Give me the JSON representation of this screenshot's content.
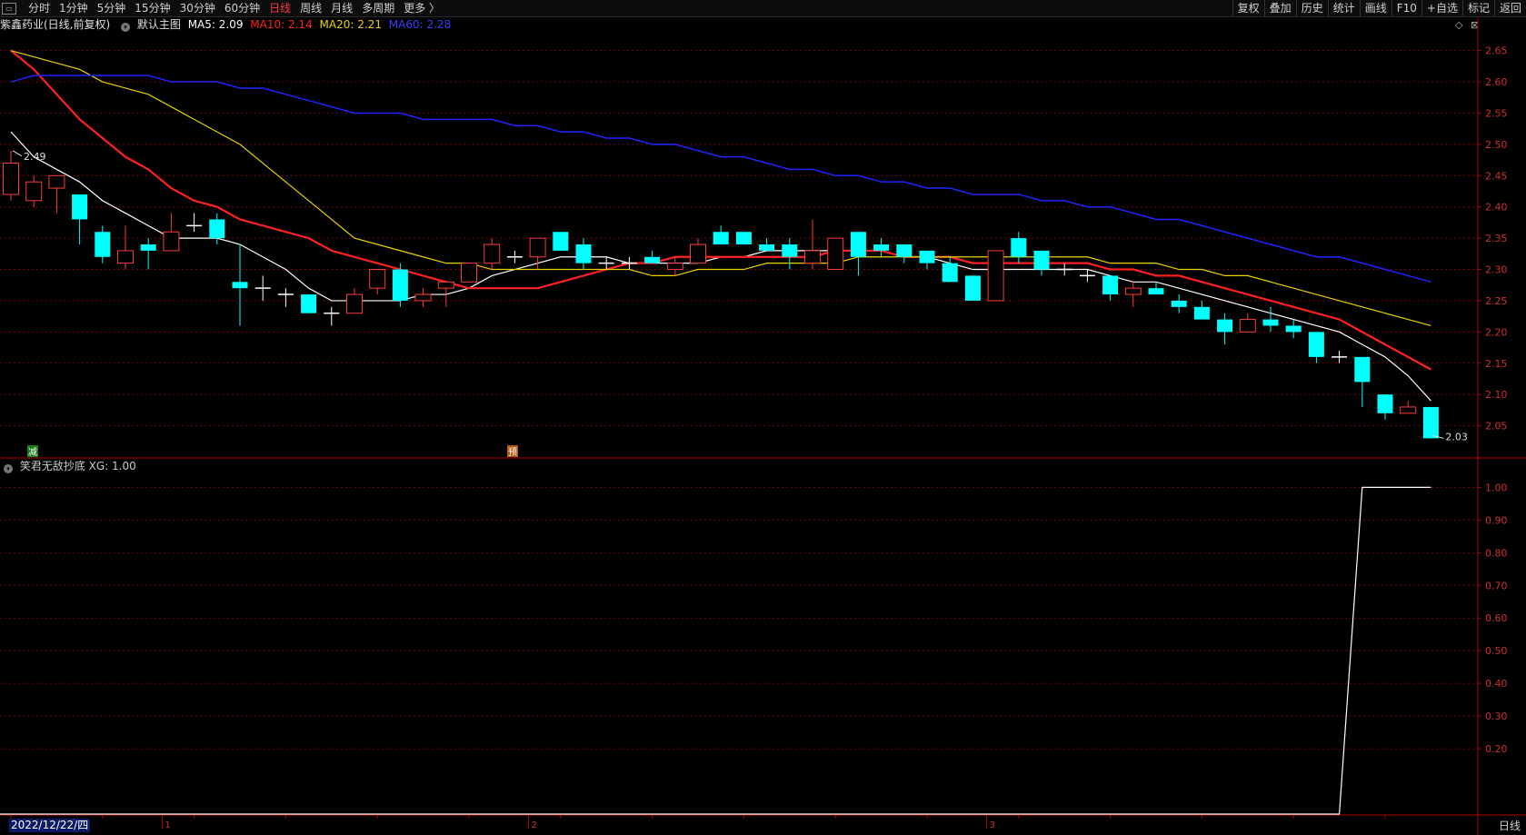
{
  "toolbar": {
    "periods": [
      "分时",
      "1分钟",
      "5分钟",
      "15分钟",
      "30分钟",
      "60分钟",
      "日线",
      "周线",
      "月线",
      "多周期",
      "更多 〉"
    ],
    "active_period": "日线",
    "tools": [
      "复权",
      "叠加",
      "历史",
      "统计",
      "画线",
      "F10",
      "+自选",
      "标记",
      "返回"
    ]
  },
  "info": {
    "stock": "紫鑫药业(日线,前复权)",
    "main_chart": "默认主图",
    "ma5": "MA5: 2.09",
    "ma10": "MA10: 2.14",
    "ma20": "MA20: 2.21",
    "ma60": "MA60: 2.28"
  },
  "indicator": {
    "label": "笑君无敌抄底",
    "value": "XG: 1.00"
  },
  "footer": {
    "date": "2022/12/22/四",
    "period_label": "日线"
  },
  "colors": {
    "up": "#ff3b3b",
    "down": "#00ffff",
    "ma5": "#ffffff",
    "ma10": "#ff2020",
    "ma20": "#e6d200",
    "ma60": "#2222ff",
    "grid": "#7a0000",
    "axis": "#b00000"
  },
  "markers": {
    "high": "2.49",
    "low": "2.03",
    "badge1": "减",
    "badge2": "预"
  },
  "chart_data": [
    {
      "type": "candlestick",
      "title": "紫鑫药业(日线,前复权)",
      "ylim": [
        2.0,
        2.68
      ],
      "yticks": [
        "2.65",
        "2.60",
        "2.55",
        "2.50",
        "2.45",
        "2.40",
        "2.35",
        "2.30",
        "2.25",
        "2.20",
        "2.15",
        "2.10",
        "2.05"
      ],
      "x_markers": [
        "1",
        "2",
        "3"
      ],
      "candles": [
        {
          "o": 2.42,
          "h": 2.49,
          "l": 2.41,
          "c": 2.47
        },
        {
          "o": 2.41,
          "h": 2.45,
          "l": 2.4,
          "c": 2.44
        },
        {
          "o": 2.43,
          "h": 2.45,
          "l": 2.39,
          "c": 2.45
        },
        {
          "o": 2.42,
          "h": 2.42,
          "l": 2.34,
          "c": 2.38
        },
        {
          "o": 2.36,
          "h": 2.37,
          "l": 2.31,
          "c": 2.32
        },
        {
          "o": 2.31,
          "h": 2.37,
          "l": 2.3,
          "c": 2.33
        },
        {
          "o": 2.34,
          "h": 2.35,
          "l": 2.3,
          "c": 2.33
        },
        {
          "o": 2.33,
          "h": 2.39,
          "l": 2.33,
          "c": 2.36
        },
        {
          "o": 2.37,
          "h": 2.39,
          "l": 2.36,
          "c": 2.37
        },
        {
          "o": 2.38,
          "h": 2.39,
          "l": 2.34,
          "c": 2.35
        },
        {
          "o": 2.28,
          "h": 2.34,
          "l": 2.21,
          "c": 2.27
        },
        {
          "o": 2.27,
          "h": 2.29,
          "l": 2.25,
          "c": 2.27
        },
        {
          "o": 2.26,
          "h": 2.27,
          "l": 2.24,
          "c": 2.26
        },
        {
          "o": 2.26,
          "h": 2.26,
          "l": 2.23,
          "c": 2.23
        },
        {
          "o": 2.23,
          "h": 2.24,
          "l": 2.21,
          "c": 2.23
        },
        {
          "o": 2.23,
          "h": 2.27,
          "l": 2.23,
          "c": 2.26
        },
        {
          "o": 2.27,
          "h": 2.3,
          "l": 2.26,
          "c": 2.3
        },
        {
          "o": 2.3,
          "h": 2.31,
          "l": 2.24,
          "c": 2.25
        },
        {
          "o": 2.25,
          "h": 2.27,
          "l": 2.24,
          "c": 2.26
        },
        {
          "o": 2.27,
          "h": 2.28,
          "l": 2.24,
          "c": 2.28
        },
        {
          "o": 2.28,
          "h": 2.31,
          "l": 2.28,
          "c": 2.31
        },
        {
          "o": 2.31,
          "h": 2.35,
          "l": 2.3,
          "c": 2.34
        },
        {
          "o": 2.32,
          "h": 2.33,
          "l": 2.31,
          "c": 2.32
        },
        {
          "o": 2.32,
          "h": 2.35,
          "l": 2.3,
          "c": 2.35
        },
        {
          "o": 2.36,
          "h": 2.36,
          "l": 2.33,
          "c": 2.33
        },
        {
          "o": 2.34,
          "h": 2.35,
          "l": 2.3,
          "c": 2.31
        },
        {
          "o": 2.31,
          "h": 2.32,
          "l": 2.3,
          "c": 2.31
        },
        {
          "o": 2.31,
          "h": 2.32,
          "l": 2.3,
          "c": 2.31
        },
        {
          "o": 2.32,
          "h": 2.33,
          "l": 2.31,
          "c": 2.31
        },
        {
          "o": 2.3,
          "h": 2.32,
          "l": 2.29,
          "c": 2.31
        },
        {
          "o": 2.31,
          "h": 2.35,
          "l": 2.31,
          "c": 2.34
        },
        {
          "o": 2.36,
          "h": 2.37,
          "l": 2.34,
          "c": 2.34
        },
        {
          "o": 2.36,
          "h": 2.36,
          "l": 2.34,
          "c": 2.34
        },
        {
          "o": 2.34,
          "h": 2.35,
          "l": 2.33,
          "c": 2.33
        },
        {
          "o": 2.34,
          "h": 2.35,
          "l": 2.3,
          "c": 2.32
        },
        {
          "o": 2.31,
          "h": 2.38,
          "l": 2.3,
          "c": 2.33
        },
        {
          "o": 2.3,
          "h": 2.35,
          "l": 2.3,
          "c": 2.35
        },
        {
          "o": 2.36,
          "h": 2.36,
          "l": 2.29,
          "c": 2.32
        },
        {
          "o": 2.34,
          "h": 2.35,
          "l": 2.32,
          "c": 2.33
        },
        {
          "o": 2.34,
          "h": 2.34,
          "l": 2.31,
          "c": 2.32
        },
        {
          "o": 2.33,
          "h": 2.33,
          "l": 2.3,
          "c": 2.31
        },
        {
          "o": 2.31,
          "h": 2.32,
          "l": 2.28,
          "c": 2.28
        },
        {
          "o": 2.29,
          "h": 2.29,
          "l": 2.25,
          "c": 2.25
        },
        {
          "o": 2.25,
          "h": 2.33,
          "l": 2.25,
          "c": 2.33
        },
        {
          "o": 2.35,
          "h": 2.36,
          "l": 2.31,
          "c": 2.32
        },
        {
          "o": 2.33,
          "h": 2.33,
          "l": 2.29,
          "c": 2.3
        },
        {
          "o": 2.3,
          "h": 2.31,
          "l": 2.29,
          "c": 2.3
        },
        {
          "o": 2.29,
          "h": 2.3,
          "l": 2.28,
          "c": 2.29
        },
        {
          "o": 2.29,
          "h": 2.29,
          "l": 2.25,
          "c": 2.26
        },
        {
          "o": 2.26,
          "h": 2.28,
          "l": 2.24,
          "c": 2.27
        },
        {
          "o": 2.27,
          "h": 2.28,
          "l": 2.26,
          "c": 2.26
        },
        {
          "o": 2.25,
          "h": 2.26,
          "l": 2.23,
          "c": 2.24
        },
        {
          "o": 2.24,
          "h": 2.25,
          "l": 2.22,
          "c": 2.22
        },
        {
          "o": 2.22,
          "h": 2.23,
          "l": 2.18,
          "c": 2.2
        },
        {
          "o": 2.2,
          "h": 2.23,
          "l": 2.2,
          "c": 2.22
        },
        {
          "o": 2.22,
          "h": 2.24,
          "l": 2.2,
          "c": 2.21
        },
        {
          "o": 2.21,
          "h": 2.22,
          "l": 2.19,
          "c": 2.2
        },
        {
          "o": 2.2,
          "h": 2.2,
          "l": 2.15,
          "c": 2.16
        },
        {
          "o": 2.16,
          "h": 2.17,
          "l": 2.15,
          "c": 2.16
        },
        {
          "o": 2.16,
          "h": 2.16,
          "l": 2.08,
          "c": 2.12
        },
        {
          "o": 2.1,
          "h": 2.1,
          "l": 2.06,
          "c": 2.07
        },
        {
          "o": 2.07,
          "h": 2.09,
          "l": 2.07,
          "c": 2.08
        },
        {
          "o": 2.08,
          "h": 2.08,
          "l": 2.03,
          "c": 2.03
        }
      ],
      "series": [
        {
          "name": "MA5",
          "values": [
            2.52,
            2.48,
            2.46,
            2.44,
            2.41,
            2.39,
            2.37,
            2.35,
            2.35,
            2.35,
            2.34,
            2.32,
            2.3,
            2.27,
            2.25,
            2.25,
            2.25,
            2.25,
            2.26,
            2.26,
            2.27,
            2.29,
            2.3,
            2.31,
            2.32,
            2.32,
            2.32,
            2.31,
            2.31,
            2.31,
            2.31,
            2.32,
            2.32,
            2.33,
            2.33,
            2.33,
            2.33,
            2.33,
            2.33,
            2.32,
            2.32,
            2.31,
            2.3,
            2.3,
            2.3,
            2.3,
            2.3,
            2.3,
            2.29,
            2.28,
            2.28,
            2.27,
            2.26,
            2.25,
            2.24,
            2.23,
            2.22,
            2.21,
            2.2,
            2.18,
            2.16,
            2.13,
            2.09
          ]
        },
        {
          "name": "MA10",
          "values": [
            2.65,
            2.62,
            2.58,
            2.54,
            2.51,
            2.48,
            2.46,
            2.43,
            2.41,
            2.4,
            2.38,
            2.37,
            2.36,
            2.35,
            2.33,
            2.32,
            2.31,
            2.3,
            2.29,
            2.28,
            2.27,
            2.27,
            2.27,
            2.27,
            2.28,
            2.29,
            2.3,
            2.31,
            2.31,
            2.32,
            2.32,
            2.32,
            2.32,
            2.32,
            2.32,
            2.32,
            2.33,
            2.33,
            2.33,
            2.32,
            2.32,
            2.32,
            2.31,
            2.31,
            2.31,
            2.31,
            2.31,
            2.31,
            2.3,
            2.3,
            2.29,
            2.29,
            2.28,
            2.27,
            2.26,
            2.25,
            2.24,
            2.23,
            2.22,
            2.2,
            2.18,
            2.16,
            2.14
          ]
        },
        {
          "name": "MA20",
          "values": [
            2.65,
            2.64,
            2.63,
            2.62,
            2.6,
            2.59,
            2.58,
            2.56,
            2.54,
            2.52,
            2.5,
            2.47,
            2.44,
            2.41,
            2.38,
            2.35,
            2.34,
            2.33,
            2.32,
            2.31,
            2.31,
            2.3,
            2.3,
            2.3,
            2.3,
            2.3,
            2.3,
            2.3,
            2.29,
            2.29,
            2.3,
            2.3,
            2.3,
            2.31,
            2.31,
            2.31,
            2.31,
            2.32,
            2.32,
            2.32,
            2.32,
            2.32,
            2.32,
            2.32,
            2.32,
            2.32,
            2.32,
            2.32,
            2.31,
            2.31,
            2.31,
            2.3,
            2.3,
            2.29,
            2.29,
            2.28,
            2.27,
            2.26,
            2.25,
            2.24,
            2.23,
            2.22,
            2.21
          ]
        },
        {
          "name": "MA60",
          "values": [
            2.6,
            2.61,
            2.61,
            2.61,
            2.61,
            2.61,
            2.61,
            2.6,
            2.6,
            2.6,
            2.59,
            2.59,
            2.58,
            2.57,
            2.56,
            2.55,
            2.55,
            2.55,
            2.54,
            2.54,
            2.54,
            2.54,
            2.53,
            2.53,
            2.52,
            2.52,
            2.51,
            2.51,
            2.5,
            2.5,
            2.49,
            2.48,
            2.48,
            2.47,
            2.46,
            2.46,
            2.45,
            2.45,
            2.44,
            2.44,
            2.43,
            2.43,
            2.42,
            2.42,
            2.42,
            2.41,
            2.41,
            2.4,
            2.4,
            2.39,
            2.38,
            2.38,
            2.37,
            2.36,
            2.35,
            2.34,
            2.33,
            2.32,
            2.32,
            2.31,
            2.3,
            2.29,
            2.28
          ]
        }
      ]
    },
    {
      "type": "line",
      "title": "笑君无敌抄底",
      "ylim": [
        0.0,
        1.04
      ],
      "yticks": [
        "1.00",
        "0.90",
        "0.80",
        "0.70",
        "0.60",
        "0.50",
        "0.40",
        "0.30",
        "0.20"
      ],
      "series": [
        {
          "name": "XG",
          "values": [
            0,
            0,
            0,
            0,
            0,
            0,
            0,
            0,
            0,
            0,
            0,
            0,
            0,
            0,
            0,
            0,
            0,
            0,
            0,
            0,
            0,
            0,
            0,
            0,
            0,
            0,
            0,
            0,
            0,
            0,
            0,
            0,
            0,
            0,
            0,
            0,
            0,
            0,
            0,
            0,
            0,
            0,
            0,
            0,
            0,
            0,
            0,
            0,
            0,
            0,
            0,
            0,
            0,
            0,
            0,
            0,
            0,
            0,
            0,
            1,
            1,
            1,
            1
          ]
        }
      ]
    }
  ]
}
